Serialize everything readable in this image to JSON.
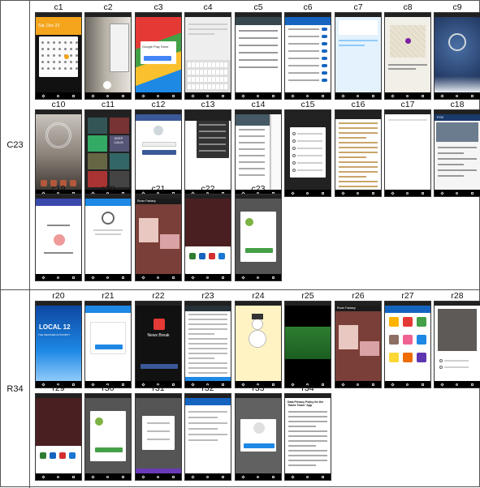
{
  "groups": [
    {
      "id": "C23",
      "label": "C23",
      "tiles": [
        "c1",
        "c2",
        "c3",
        "c4",
        "c5",
        "c6",
        "c7",
        "c8",
        "c9",
        "c10",
        "c11",
        "c12",
        "c13",
        "c14",
        "c15",
        "c16",
        "c17",
        "c18",
        "c19",
        "c20",
        "c21",
        "c22",
        "c23"
      ]
    },
    {
      "id": "R34",
      "label": "R34",
      "tiles": [
        "r20",
        "r21",
        "r22",
        "r23",
        "r24",
        "r25",
        "r26",
        "r27",
        "r28",
        "r29",
        "r30",
        "r31",
        "r32",
        "r33",
        "r34"
      ]
    }
  ],
  "colors": {
    "border": "#555555",
    "status_bar": "#212121",
    "nav_bar": "#000000"
  },
  "screens": {
    "c1": {
      "header_text": "Sat, Dec 23"
    },
    "c3": {
      "header_text": "Google Play Store"
    },
    "c11": {
      "overlay_text": "KEEP CALM"
    },
    "c18": {
      "header_text": "FOX"
    },
    "c21": {
      "header_text": "Room Fantasy"
    },
    "c22": {
      "header_text": ""
    },
    "r20": {
      "header_text": "LOCAL 12",
      "subtitle": "THE WEATHER AUTHORITY"
    },
    "r22": {
      "header_text": "News Break"
    },
    "r23": {
      "header_text": "Terms & Conditions"
    },
    "r26": {
      "header_text": "Room Fantasy"
    },
    "r27": {
      "header_text": "English"
    },
    "r34": {
      "header_text": "Data Privacy Policy for the 'Game Tower' App"
    }
  }
}
